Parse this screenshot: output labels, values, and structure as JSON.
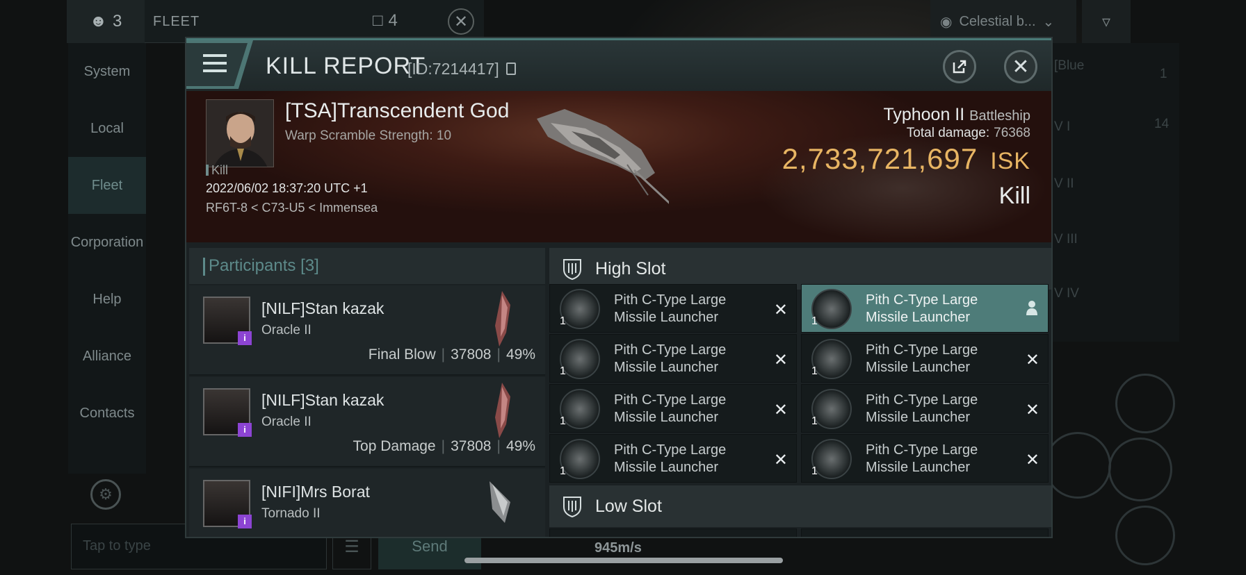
{
  "background": {
    "fleet_count": "3",
    "fleet_label": "FLEET",
    "fleet_right_count": "4",
    "sidebar": [
      "System",
      "Local",
      "Fleet",
      "Corporation",
      "Help",
      "Alliance",
      "Contacts"
    ],
    "chat_placeholder": "Tap to type",
    "send_label": "Send",
    "speed": "945m/s",
    "celestial_filter": "Celestial b...",
    "right_texts": [
      "[Blue",
      "1",
      "14",
      "V I",
      "V II",
      "V III",
      "V IV"
    ]
  },
  "report": {
    "title": "KILL REPORT",
    "id": "[ID:7214417]",
    "victim": {
      "name": "[TSA]Transcendent God",
      "scramble": "Warp Scramble Strength: 10",
      "tag": "Kill",
      "date": "2022/06/02 18:37:20 UTC +1",
      "location": "RF6T-8 < C73-U5 < Immensea"
    },
    "ship": {
      "name": "Typhoon II",
      "class": "Battleship",
      "damage_label": "Total damage:",
      "damage_value": "76368",
      "isk_value": "2,733,721,697",
      "isk_unit": "ISK",
      "result": "Kill"
    },
    "participants_label": "Participants",
    "participants_count": "[3]",
    "participants": [
      {
        "name": "[NILF]Stan kazak",
        "ship": "Oracle II",
        "role": "Final Blow",
        "damage": "37808",
        "percent": "49%"
      },
      {
        "name": "[NILF]Stan kazak",
        "ship": "Oracle II",
        "role": "Top Damage",
        "damage": "37808",
        "percent": "49%"
      },
      {
        "name": "[NIFI]Mrs Borat",
        "ship": "Tornado II"
      }
    ],
    "high_slot_label": "High Slot",
    "low_slot_label": "Low Slot",
    "modules": [
      {
        "name": "Pith C-Type Large Missile Launcher",
        "qty": "1"
      },
      {
        "name": "Pith C-Type Large Missile Launcher",
        "qty": "1"
      },
      {
        "name": "Pith C-Type Large Missile Launcher",
        "qty": "1"
      },
      {
        "name": "Pith C-Type Large Missile Launcher",
        "qty": "1"
      },
      {
        "name": "Pith C-Type Large Missile Launcher",
        "qty": "1"
      },
      {
        "name": "Pith C-Type Large Missile Launcher",
        "qty": "1"
      },
      {
        "name": "Pith C-Type Large Missile Launcher",
        "qty": "1"
      },
      {
        "name": "Pith C-Type Large Missile Launcher",
        "qty": "1"
      }
    ],
    "colors": {
      "accent": "#4e7c79",
      "isk": "#e8b563",
      "tag": "#8c44d3"
    }
  }
}
